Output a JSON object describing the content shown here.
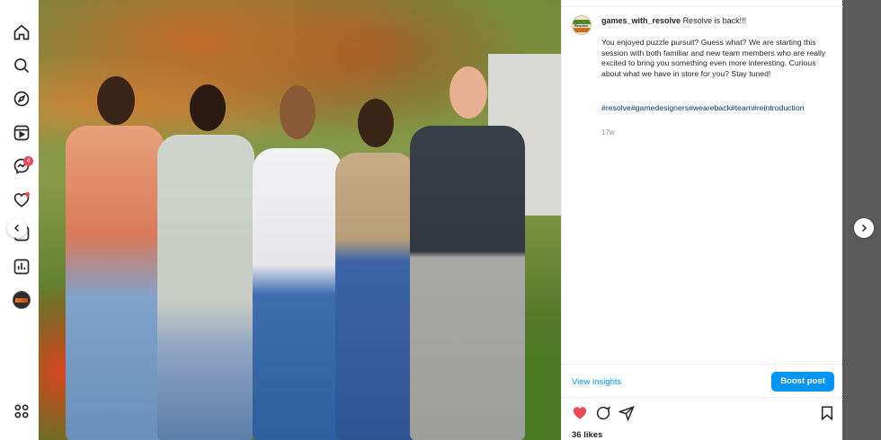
{
  "nav": {
    "items": [
      {
        "name": "home-icon"
      },
      {
        "name": "search-icon"
      },
      {
        "name": "explore-icon"
      },
      {
        "name": "reels-icon"
      },
      {
        "name": "messages-icon"
      },
      {
        "name": "notifications-icon"
      },
      {
        "name": "create-icon"
      },
      {
        "name": "dashboard-icon"
      },
      {
        "name": "profile-avatar"
      },
      {
        "name": "more-icon"
      }
    ],
    "messages_badge": "4"
  },
  "post": {
    "author": "games_with_resolve",
    "avatar_text": "Resolve",
    "headline": "Resolve is back!!!",
    "caption": "You enjoyed puzzle pursuit? Guess what? We are starting this session with both familiar and new team members who are really excited to bring you something even more interesting. Curious about what we have in store for you? Stay tuned!",
    "hashtags": "#resolve#gamedesigners#weareback#team#reintroduction",
    "timestamp": "17w"
  },
  "actions": {
    "view_insights": "View insights",
    "boost_post": "Boost post",
    "likes": "36 likes",
    "liked": true
  },
  "colors": {
    "accent": "#0095f6",
    "like": "#ed4956",
    "hashtag": "#00376b",
    "backdrop": "#5b5b5b"
  }
}
